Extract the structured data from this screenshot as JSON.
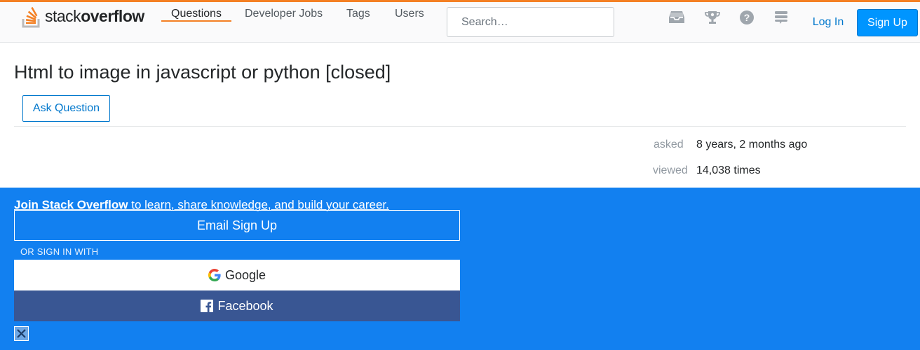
{
  "header": {
    "logo": {
      "light": "stack",
      "bold": "overflow"
    },
    "nav": [
      {
        "label": "Questions"
      },
      {
        "label": "Developer Jobs"
      },
      {
        "label": "Tags"
      },
      {
        "label": "Users"
      }
    ],
    "search_placeholder": "Search…",
    "icons": [
      "inbox-icon",
      "achievements-icon",
      "help-icon",
      "site-switcher-icon"
    ],
    "login_label": "Log In",
    "signup_label": "Sign Up"
  },
  "question": {
    "title": "Html to image in javascript or python [closed]",
    "ask_button": "Ask Question",
    "asked_label": "asked",
    "asked_value": "8 years, 2 months ago",
    "viewed_label": "viewed",
    "viewed_value": "14,038 times"
  },
  "banner": {
    "join_bold": "Join Stack Overflow",
    "join_rest": " to learn, share knowledge, and build your career.",
    "email_button": "Email Sign Up",
    "or_text": "OR SIGN IN WITH",
    "google_button": "Google",
    "facebook_button": "Facebook"
  },
  "colors": {
    "accent": "#f48024",
    "link": "#0077cc",
    "signup": "#0095ff",
    "banner": "#1280f0",
    "facebook": "#395693"
  }
}
